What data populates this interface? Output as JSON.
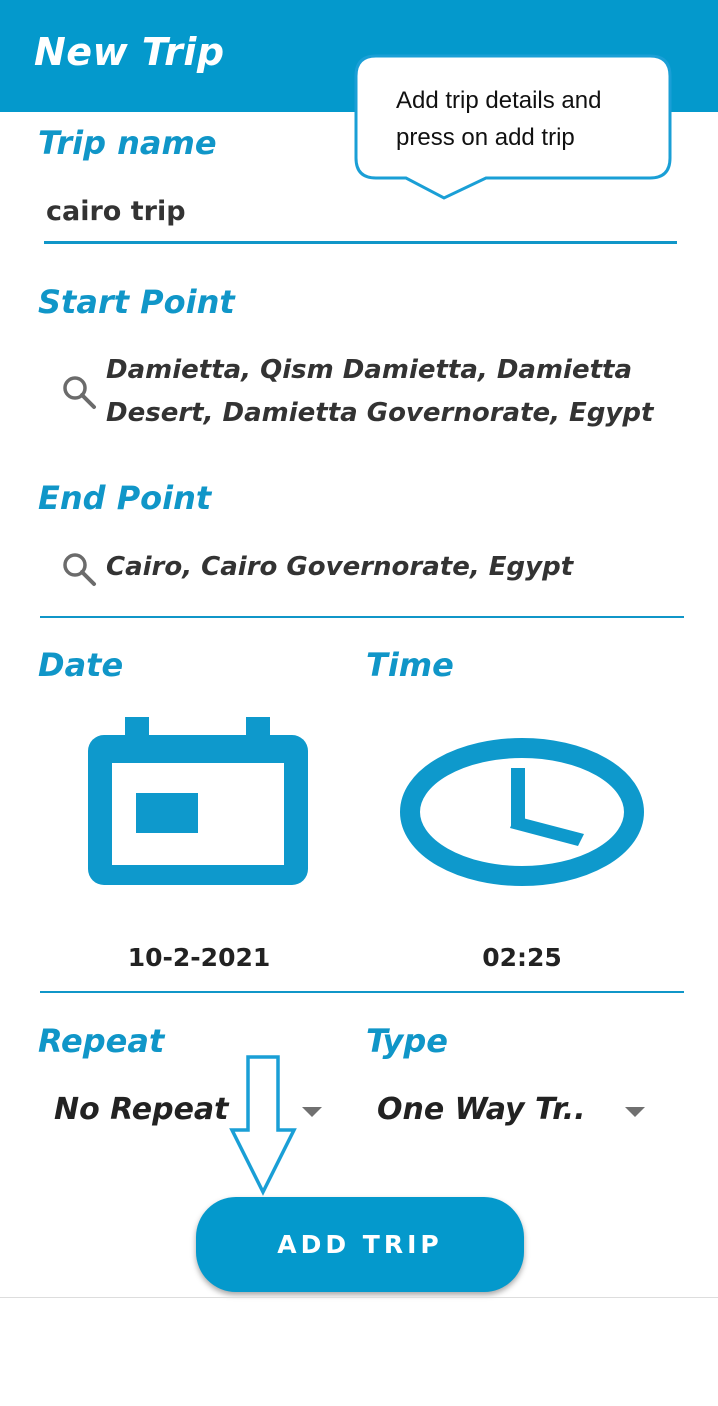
{
  "appbar": {
    "title": "New Trip"
  },
  "callout": {
    "text": "Add trip details and press on add trip"
  },
  "trip_name": {
    "label": "Trip name",
    "value": "cairo trip"
  },
  "start_point": {
    "label": "Start Point",
    "value": "Damietta, Qism Damietta, Damietta Desert, Damietta Governorate, Egypt",
    "icon": "search-icon"
  },
  "end_point": {
    "label": "End Point",
    "value": "Cairo, Cairo Governorate, Egypt",
    "icon": "search-icon"
  },
  "date": {
    "label": "Date",
    "value": "10-2-2021",
    "icon": "calendar-icon"
  },
  "time": {
    "label": "Time",
    "value": "02:25",
    "icon": "clock-icon"
  },
  "repeat": {
    "label": "Repeat",
    "selected": "No Repeat"
  },
  "type": {
    "label": "Type",
    "selected": "One Way Tr.."
  },
  "add_button": {
    "label": "ADD TRIP"
  },
  "colors": {
    "primary": "#0499cc",
    "accent_text": "#1096c8",
    "text": "#333333"
  }
}
